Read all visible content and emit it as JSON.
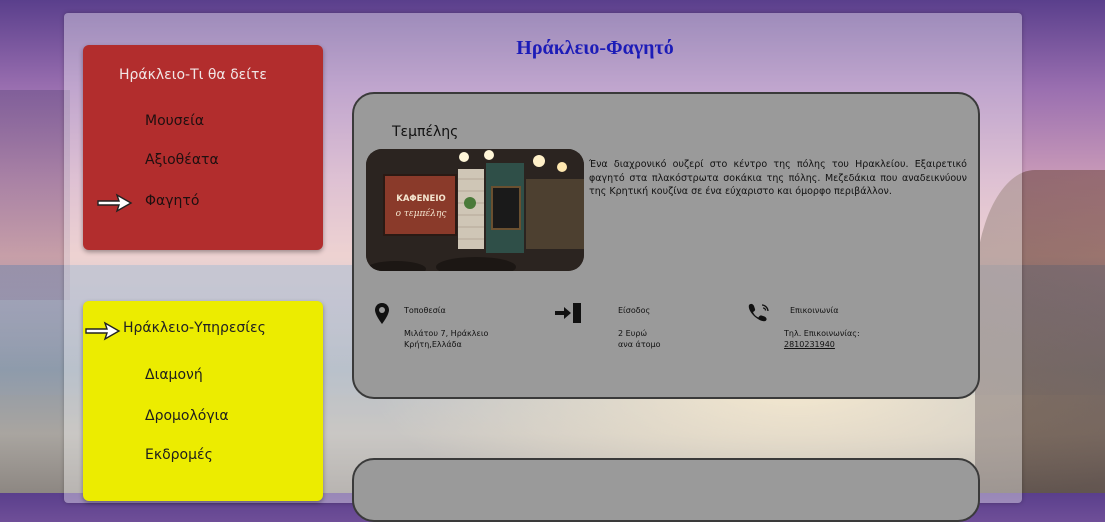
{
  "page": {
    "title": "Ηράκλειο-Φαγητό"
  },
  "menu_top": {
    "heading": "Ηράκλειο-Τι θα δείτε",
    "items": [
      "Μουσεία",
      "Αξιοθέατα",
      "Φαγητό"
    ],
    "active_index": 2,
    "color": "#b22d2d"
  },
  "menu_bottom": {
    "heading": "Ηράκλειο-Υπηρεσίες",
    "items": [
      "Διαμονή",
      "Δρομολόγια",
      "Εκδρομές"
    ],
    "heading_active": true,
    "color": "#ecec00"
  },
  "cards": [
    {
      "title": "Τεμπέλης",
      "description": "Ένα διαχρονικό ουζερί στο κέντρο της πόλης του Ηρακλείου. Εξαιρετικό φαγητό στα πλακόστρωτα σοκάκια της πόλης. Μεζεδάκια που αναδεικνύουν της Κρητική κουζίνα σε ένα εύχαριστο και όμορφο περιβάλλον.",
      "photo": {
        "sign_line1": "ΚΑΦΕΝΕΙΟ",
        "sign_line2": "ο τεμπέλης"
      },
      "info": {
        "location": {
          "label": "Τοποθεσία",
          "line1": "Μιλάτου 7, Ηράκλειο",
          "line2": "Κρήτη,Ελλάδα",
          "icon": "location-pin-icon"
        },
        "entry": {
          "label": "Είσοδος",
          "line1": "2 Ευρώ",
          "line2": "ανα άτομο",
          "icon": "entrance-icon"
        },
        "contact": {
          "label": "Επικοινωνία",
          "line1": "Τηλ. Επικοινωνίας:",
          "phone": "2810231940",
          "icon": "phone-icon"
        }
      }
    }
  ],
  "colors": {
    "title": "#1c1cb8",
    "card_bg": "#9a9a9a"
  }
}
